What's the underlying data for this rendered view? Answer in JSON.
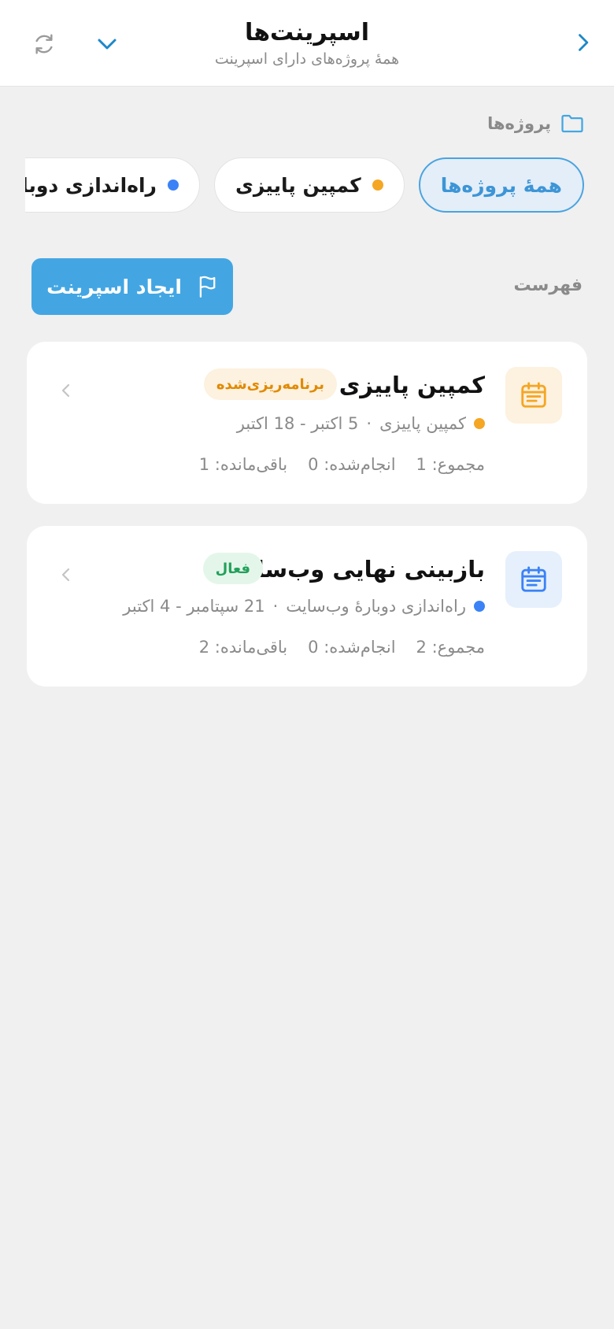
{
  "header": {
    "title": "اسپرینت‌ها",
    "subtitle": "همهٔ پروژه‌های دارای اسپرینت",
    "back_icon": "chevron-right-icon",
    "dropdown_icon": "chevron-down-icon",
    "refresh_icon": "refresh-icon",
    "accent": "#1e88c8"
  },
  "projects": {
    "label": "پروژه‌ها",
    "icon": "folder-icon",
    "chips": [
      {
        "label": "همهٔ پروژه‌ها",
        "active": true
      },
      {
        "label": "کمپین پاییزی",
        "dot_color": "#f5a623"
      },
      {
        "label": "راه‌اندازی دوبارهٔ وب‌سایت",
        "dot_color": "#3b82f6"
      }
    ]
  },
  "list": {
    "label": "فهرست",
    "create_button": "ایجاد اسپرینت",
    "create_icon": "flag-icon"
  },
  "sprints": [
    {
      "name": "کمپین پاییزی",
      "status": "برنامه‌ریزی‌شده",
      "status_color": "#e08a00",
      "status_bg": "#fdf1df",
      "project": "کمپین پاییزی",
      "project_dot": "#f5a623",
      "separator": "·",
      "dates": "5 اکتبر - 18 اکتبر",
      "stats": {
        "total": "مجموع: 1",
        "done": "انجام‌شده: 0",
        "remaining": "باقی‌مانده: 1"
      },
      "icon": "calendar-icon",
      "icon_color": "#f5a623",
      "icon_bg": "#fdf1df"
    },
    {
      "name": "بازبینی نهایی وب‌سایت",
      "status": "فعال",
      "status_color": "#22a05a",
      "status_bg": "#e4f6ea",
      "project": "راه‌اندازی دوبارهٔ وب‌سایت",
      "project_dot": "#3b82f6",
      "separator": "·",
      "dates": "21 سپتامبر - 4 اکتبر",
      "stats": {
        "total": "مجموع: 2",
        "done": "انجام‌شده: 0",
        "remaining": "باقی‌مانده: 2"
      },
      "icon": "calendar-icon",
      "icon_color": "#3b82f6",
      "icon_bg": "#e6f0fc"
    }
  ]
}
